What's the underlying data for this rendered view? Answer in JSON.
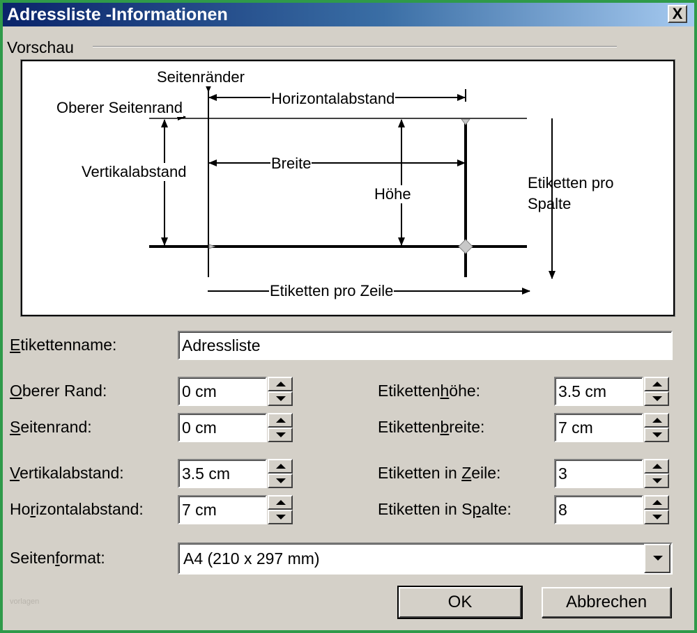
{
  "window": {
    "title": "Adressliste -Informationen",
    "close_label": "X"
  },
  "preview": {
    "group_label": "Vorschau",
    "labels": {
      "seitenraender": "Seitenränder",
      "oberer_seitenrand": "Oberer Seitenrand",
      "horizontalabstand": "Horizontalabstand",
      "vertikalabstand": "Vertikalabstand",
      "breite": "Breite",
      "hoehe": "Höhe",
      "etiketten_pro_spalte_1": "Etiketten pro",
      "etiketten_pro_spalte_2": "Spalte",
      "etiketten_pro_zeile": "Etiketten pro Zeile"
    }
  },
  "form": {
    "etikettenname": {
      "label_ul": "E",
      "label_rest": "tikettenname:",
      "value": "Adressliste"
    },
    "oberer_rand": {
      "label_ul": "O",
      "label_rest": "berer Rand:",
      "value": "0 cm"
    },
    "seitenrand": {
      "label_ul": "S",
      "label_rest": "eitenrand:",
      "value": "0 cm"
    },
    "vertikalabstand": {
      "label_ul": "V",
      "label_rest": "ertikalabstand:",
      "value": "3.5 cm"
    },
    "horizontalabstand": {
      "label_pre": "Ho",
      "label_ul": "r",
      "label_rest": "izontalabstand:",
      "value": "7 cm"
    },
    "etikettenhoehe": {
      "label_pre": "Etiketten",
      "label_ul": "h",
      "label_rest": "öhe:",
      "value": "3.5 cm"
    },
    "etikettenbreite": {
      "label_pre": "Etiketten",
      "label_ul": "b",
      "label_rest": "reite:",
      "value": "7 cm"
    },
    "etiketten_in_zeile": {
      "label_pre": "Etiketten in ",
      "label_ul": "Z",
      "label_rest": "eile:",
      "value": "3"
    },
    "etiketten_in_spalte": {
      "label_pre": "Etiketten in S",
      "label_ul": "p",
      "label_rest": "alte:",
      "value": "8"
    },
    "seitenformat": {
      "label_pre": "Seiten",
      "label_ul": "f",
      "label_rest": "ormat:",
      "value": "A4 (210 x 297 mm)"
    }
  },
  "buttons": {
    "ok": "OK",
    "cancel": "Abbrechen"
  },
  "watermark": "vorlagen"
}
